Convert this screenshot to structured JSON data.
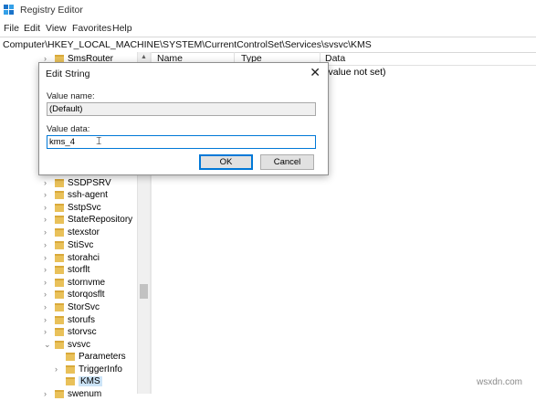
{
  "window": {
    "title": "Registry Editor",
    "icon": "registry-icon",
    "accent": "#0078d7"
  },
  "menu": [
    "File",
    "Edit",
    "View",
    "Favorites",
    "Help"
  ],
  "address": "Computer\\HKEY_LOCAL_MACHINE\\SYSTEM\\CurrentControlSet\\Services\\svsvc\\KMS",
  "tree": {
    "items": [
      {
        "label": "SmsRouter",
        "expandable": true
      },
      {
        "label": "SSDPSRV",
        "expandable": true
      },
      {
        "label": "ssh-agent",
        "expandable": true
      },
      {
        "label": "SstpSvc",
        "expandable": true
      },
      {
        "label": "StateRepository",
        "expandable": true
      },
      {
        "label": "stexstor",
        "expandable": true
      },
      {
        "label": "StiSvc",
        "expandable": true
      },
      {
        "label": "storahci",
        "expandable": true
      },
      {
        "label": "storflt",
        "expandable": true
      },
      {
        "label": "stornvme",
        "expandable": true
      },
      {
        "label": "storqosflt",
        "expandable": true
      },
      {
        "label": "StorSvc",
        "expandable": true
      },
      {
        "label": "storufs",
        "expandable": true
      },
      {
        "label": "storvsc",
        "expandable": true
      },
      {
        "label": "svsvc",
        "expandable": true,
        "expanded": true
      },
      {
        "label": "Parameters",
        "expandable": false,
        "child": true
      },
      {
        "label": "TriggerInfo",
        "expandable": true,
        "child": true
      },
      {
        "label": "KMS",
        "expandable": false,
        "child": true,
        "selected": true
      },
      {
        "label": "swenum",
        "expandable": true
      }
    ]
  },
  "list": {
    "columns": [
      "Name",
      "Type",
      "Data"
    ],
    "rows": [
      {
        "name": "",
        "type": "",
        "data": "(value not set)"
      }
    ]
  },
  "dialog": {
    "title": "Edit String",
    "value_name_label": "Value name:",
    "value_name": "(Default)",
    "value_data_label": "Value data:",
    "value_data": "kms_4",
    "ok_label": "OK",
    "cancel_label": "Cancel",
    "close_glyph": "✕"
  },
  "watermark": "wsxdn.com"
}
